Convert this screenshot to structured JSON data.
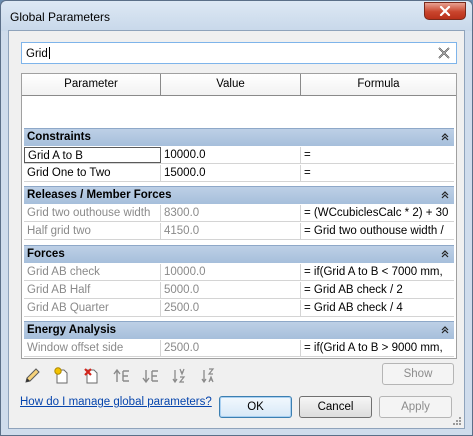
{
  "window": {
    "title": "Global Parameters"
  },
  "search": {
    "value": "Grid"
  },
  "table": {
    "columns": [
      "Parameter",
      "Value",
      "Formula"
    ],
    "groups": [
      {
        "label": "Constraints",
        "rows": [
          {
            "parameter": "Grid A to B",
            "value": "10000.0",
            "formula": "=",
            "dim": false
          },
          {
            "parameter": "Grid One to Two",
            "value": "15000.0",
            "formula": "=",
            "dim": false
          }
        ]
      },
      {
        "label": "Releases / Member Forces",
        "rows": [
          {
            "parameter": "Grid two outhouse width",
            "value": "8300.0",
            "formula": "= (WCcubiclesCalc * 2) + 30",
            "dim": true
          },
          {
            "parameter": "Half grid two",
            "value": "4150.0",
            "formula": "= Grid two outhouse width /",
            "dim": true
          }
        ]
      },
      {
        "label": "Forces",
        "rows": [
          {
            "parameter": "Grid AB check",
            "value": "10000.0",
            "formula": "= if(Grid A to B < 7000 mm,",
            "dim": true
          },
          {
            "parameter": "Grid AB Half",
            "value": "5000.0",
            "formula": "= Grid AB check / 2",
            "dim": true
          },
          {
            "parameter": "Grid AB Quarter",
            "value": "2500.0",
            "formula": "= Grid AB check / 4",
            "dim": true
          }
        ]
      },
      {
        "label": "Energy Analysis",
        "rows": [
          {
            "parameter": "Window offset side",
            "value": "2500.0",
            "formula": "= if(Grid A to B > 9000 mm,",
            "dim": true
          }
        ]
      }
    ]
  },
  "toolbar": {
    "icons": [
      "pencil-icon",
      "new-parameter-icon",
      "delete-parameter-icon",
      "move-up-icon",
      "move-down-icon",
      "sort-ascending-icon",
      "sort-descending-icon"
    ],
    "show_label": "Show"
  },
  "footer": {
    "help_link": "How do I manage global parameters?",
    "ok_label": "OK",
    "cancel_label": "Cancel",
    "apply_label": "Apply"
  },
  "colors": {
    "group_header": "#a6bfdb",
    "link": "#0645ad",
    "close_button": "#c9452d"
  }
}
